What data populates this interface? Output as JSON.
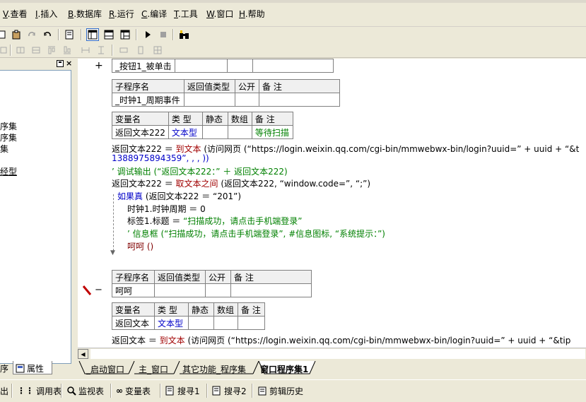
{
  "menu": {
    "items": [
      {
        "key": "V",
        "label": ".查看"
      },
      {
        "key": "I",
        "label": ".插入"
      },
      {
        "key": "B",
        "label": ".数据库"
      },
      {
        "key": "R",
        "label": ".运行"
      },
      {
        "key": "C",
        "label": ".编译"
      },
      {
        "key": "T",
        "label": ".工具"
      },
      {
        "key": "W",
        "label": ".窗口"
      },
      {
        "key": "H",
        "label": ".帮助"
      }
    ]
  },
  "left_panel": {
    "tree": [
      "序集",
      "序集",
      "集",
      "经型"
    ],
    "tabs": [
      "序",
      "属性"
    ]
  },
  "code": {
    "gutter_plus": "+",
    "gutter_minus": "−",
    "event_row": [
      "_按钮1_被单击",
      "",
      "",
      ""
    ],
    "sub1": {
      "headers": [
        "子程序名",
        "返回值类型",
        "公开",
        "备 注"
      ],
      "row": [
        "_时钟1_周期事件",
        "",
        "",
        ""
      ]
    },
    "var1": {
      "headers": [
        "变量名",
        "类 型",
        "静态",
        "数组",
        "备 注"
      ],
      "row": [
        "返回文本222",
        "文本型",
        "",
        "",
        "等待扫描"
      ]
    },
    "lines": {
      "l1_a": "返回文本222 ＝ ",
      "l1_fn": "到文本",
      "l1_b": " (访问网页 (“https://login.weixin.qq.com/cgi-bin/mmwebwx-bin/login?uuid=” + uuid + “&t",
      "l2": "1388975894359”, , , ))",
      "l3": "’ 调试输出 (“返回文本222：” ＋ 返回文本222)",
      "l4_a": "返回文本222 ＝ ",
      "l4_fn": "取文本之间",
      "l4_b": " (返回文本222, “window.code=”, “;”)",
      "l5_kw": "如果真",
      "l5_b": " (返回文本222 ＝ “201”)",
      "l6": "时钟1.时钟周期 ＝ 0",
      "l7_a": "标签1.标题 ＝ ",
      "l7_s": "“扫描成功，请点击手机端登录”",
      "l8": "’ 信息框 (“扫描成功，请点击手机端登录”, #信息图标, “系统提示：”)",
      "l9": "呵呵 ()"
    },
    "sub2": {
      "headers": [
        "子程序名",
        "返回值类型",
        "公开",
        "备 注"
      ],
      "row": [
        "呵呵",
        "",
        "",
        ""
      ]
    },
    "var2": {
      "headers": [
        "变量名",
        "类 型",
        "静态",
        "数组",
        "备 注"
      ],
      "row": [
        "返回文本",
        "文本型",
        "",
        "",
        ""
      ]
    },
    "l10_a": "返回文本 ＝ ",
    "l10_fn": "到文本",
    "l10_b": " (访问网页 (“https://login.weixin.qq.com/cgi-bin/mmwebwx-bin/login?uuid=” + uuid + “&tip"
  },
  "code_tabs": [
    "_启动窗口",
    "主_窗口",
    "其它功能_程序集",
    "窗口程序集1"
  ],
  "bottom_bar": [
    "出",
    "调用表",
    "监视表",
    "变量表",
    "搜寻1",
    "搜寻2",
    "剪辑历史"
  ],
  "colors": {
    "keyword": "#0000c8",
    "string": "#008000",
    "function": "#a00000"
  }
}
